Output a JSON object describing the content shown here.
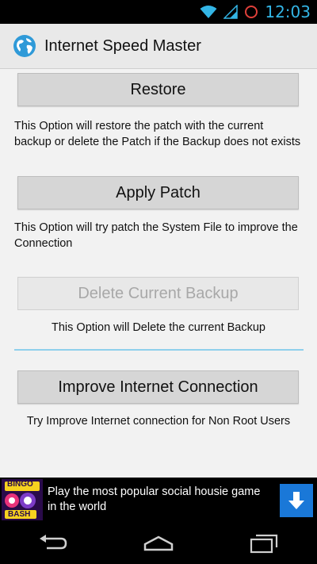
{
  "status_bar": {
    "time": "12:03",
    "icons": [
      "wifi-icon",
      "signal-icon",
      "notification-ring-icon"
    ]
  },
  "action_bar": {
    "title": "Internet Speed Master",
    "icon": "globe-icon"
  },
  "options": [
    {
      "button_label": "Restore",
      "description": "This Option will restore the patch with the current backup or delete the Patch if the Backup does not exists",
      "enabled": true
    },
    {
      "button_label": "Apply Patch",
      "description": "This Option will try patch the System File to improve the Connection",
      "enabled": true
    },
    {
      "button_label": "Delete Current Backup",
      "description": "This Option will Delete the current Backup",
      "enabled": false
    },
    {
      "button_label": "Improve Internet Connection",
      "description": "Try Improve Internet connection for Non Root Users",
      "enabled": true
    }
  ],
  "ad": {
    "logo_text_top": "BINGO",
    "logo_text_bottom": "BASH",
    "message": "Play the most popular social housie game in the world",
    "action_icon": "download-arrow-icon"
  },
  "nav_bar": {
    "buttons": [
      "back-icon",
      "home-icon",
      "recents-icon"
    ]
  },
  "colors": {
    "accent": "#33b5e5",
    "divider": "#8fd0ec",
    "ad_button": "#1a78d8"
  }
}
